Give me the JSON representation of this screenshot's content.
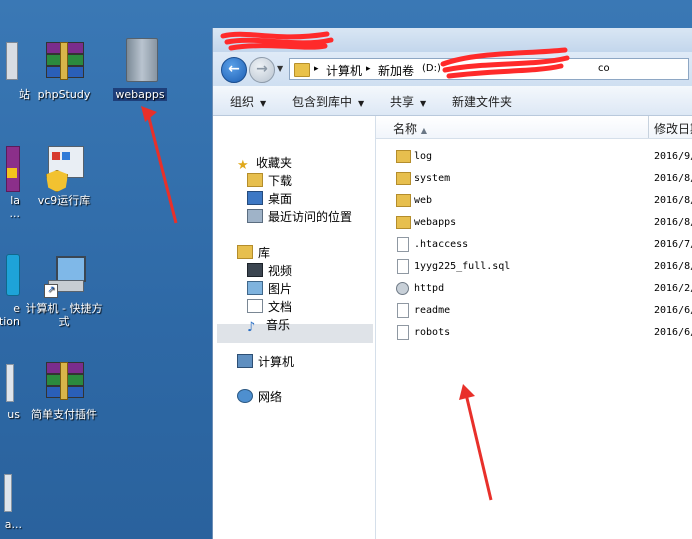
{
  "desktop": {
    "icons": [
      {
        "label": "站"
      },
      {
        "label": "phpStudy"
      },
      {
        "label": "webapps"
      },
      {
        "label": "la"
      },
      {
        "label": "..."
      },
      {
        "label": "vc9运行库"
      },
      {
        "label": "e"
      },
      {
        "label": "tion"
      },
      {
        "label": "计算机 - 快捷方式"
      },
      {
        "label": "us"
      },
      {
        "label": "简单支付插件"
      },
      {
        "label": "a..."
      }
    ]
  },
  "explorer": {
    "breadcrumbs": [
      "计算机",
      "新加卷",
      "(D:)",
      "co"
    ],
    "toolbar": {
      "organize": "组织",
      "include_in_library": "包含到库中",
      "share": "共享",
      "new_folder": "新建文件夹"
    },
    "nav": {
      "favorites": "收藏夹",
      "downloads": "下载",
      "desktop": "桌面",
      "recent": "最近访问的位置",
      "libraries": "库",
      "videos": "视频",
      "pictures": "图片",
      "documents": "文档",
      "music": "音乐",
      "computer": "计算机",
      "network": "网络"
    },
    "columns": {
      "name": "名称",
      "sort": "▲",
      "modified": "修改日期"
    },
    "files": [
      {
        "name": "log",
        "type": "folder",
        "date": "2016/9/"
      },
      {
        "name": "system",
        "type": "folder",
        "date": "2016/8/"
      },
      {
        "name": "web",
        "type": "folder",
        "date": "2016/8/"
      },
      {
        "name": "webapps",
        "type": "folder",
        "date": "2016/8/"
      },
      {
        "name": ".htaccess",
        "type": "file",
        "date": "2016/7/"
      },
      {
        "name": "1yyg225_full.sql",
        "type": "file",
        "date": "2016/8/"
      },
      {
        "name": "httpd",
        "type": "gear",
        "date": "2016/2/"
      },
      {
        "name": "readme",
        "type": "file",
        "date": "2016/6/"
      },
      {
        "name": "robots",
        "type": "file",
        "date": "2016/6/"
      }
    ]
  },
  "colors": {
    "desktop_bg": "#2f6ca8",
    "annotation_red": "#e8302a",
    "folder": "#e7bf4e"
  }
}
